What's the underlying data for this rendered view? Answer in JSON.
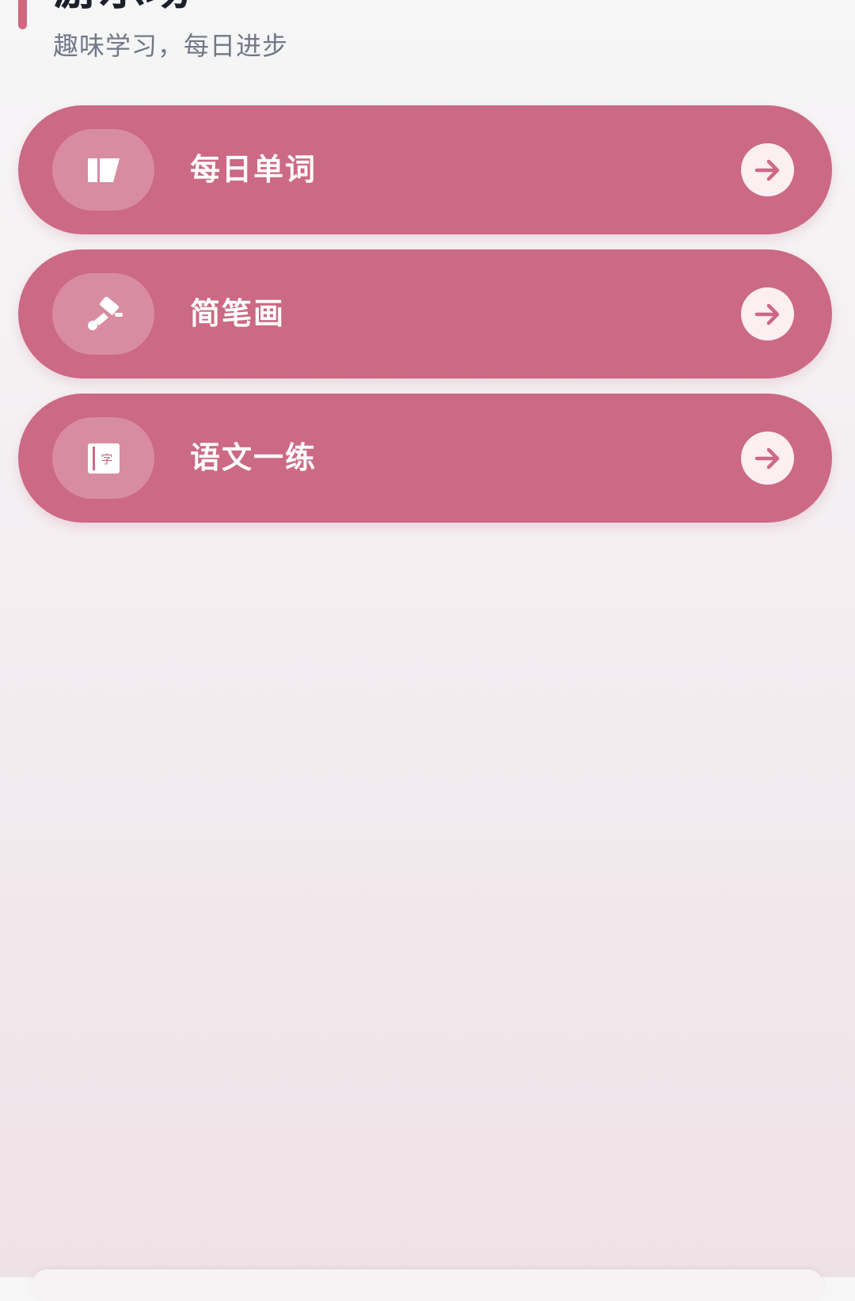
{
  "header": {
    "title": "游乐场",
    "subtitle": "趣味学习，每日进步"
  },
  "cards": [
    {
      "label": "每日单词",
      "icon": "book-icon"
    },
    {
      "label": "简笔画",
      "icon": "brush-icon"
    },
    {
      "label": "语文一练",
      "icon": "character-book-icon",
      "icon_text": "字"
    }
  ],
  "colors": {
    "accent": "#d0677f",
    "card": "#cc6985",
    "title": "#1b1f2a",
    "subtitle": "#727887"
  }
}
